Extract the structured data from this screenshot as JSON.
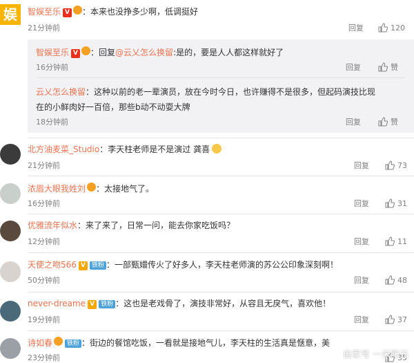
{
  "labels": {
    "reply": "回复",
    "like": "赞"
  },
  "comments": [
    {
      "name": "智娱至乐",
      "badge": "V",
      "sep": "：",
      "text": "本来也没挣多少啊，低调挺好",
      "time": "21分钟前",
      "likes": "120",
      "avatar_text": "娱"
    },
    {
      "name": "北方油麦菜_Studio",
      "sep": "：",
      "text": "李天柱老师是不是演过 龚喜",
      "time": "21分钟前",
      "likes": "73"
    },
    {
      "name": "浓眉大眼我姓刘",
      "sep": "：",
      "text": "太接地气了。",
      "time": "16分钟前",
      "likes": "31"
    },
    {
      "name": "优雅流年似水",
      "sep": "：",
      "text": "来了来了，日常一问，能去你家吃饭吗？",
      "time": "12分钟前",
      "likes": "11"
    },
    {
      "name": "天使之吻566",
      "badge": "V",
      "fan": "铁粉",
      "sep": "：",
      "text": "一部甄嬛传火了好多人，李天柱老师演的苏公公印象深刻啊！",
      "time": "50分钟前",
      "likes": "48"
    },
    {
      "name": "never-dreame",
      "badge": "V",
      "fan": "铁粉",
      "sep": "：",
      "text": "这也是老戏骨了，演技非常好，从容且无戾气，喜欢他！",
      "time": "19分钟前",
      "likes": "37"
    },
    {
      "name": "诗如春",
      "fan": "铁粉",
      "sep": "：",
      "text": "街边的餐馆吃饭，一看就是接地气儿，李天柱的生活真是惬意，美",
      "time": "23分钟前",
      "likes": "35"
    }
  ],
  "replies": [
    {
      "name": "智娱至乐",
      "badge": "V",
      "sep": "：",
      "prefix": "回复",
      "mention": "@云乂怎么换留",
      "text": ":是的，要是人人都这样就好了",
      "time": "16分钟前"
    },
    {
      "name": "云乂怎么换留",
      "sep": "：",
      "text": "这种以前的老一辈演员，放在今时今日，也许赚得不是很多，但起码演技比现",
      "text2": "在的小鲜肉好一百倍，那些b动不动耍大牌",
      "time": "18分钟前"
    }
  ],
  "watermark": "自家号 一米阳元"
}
